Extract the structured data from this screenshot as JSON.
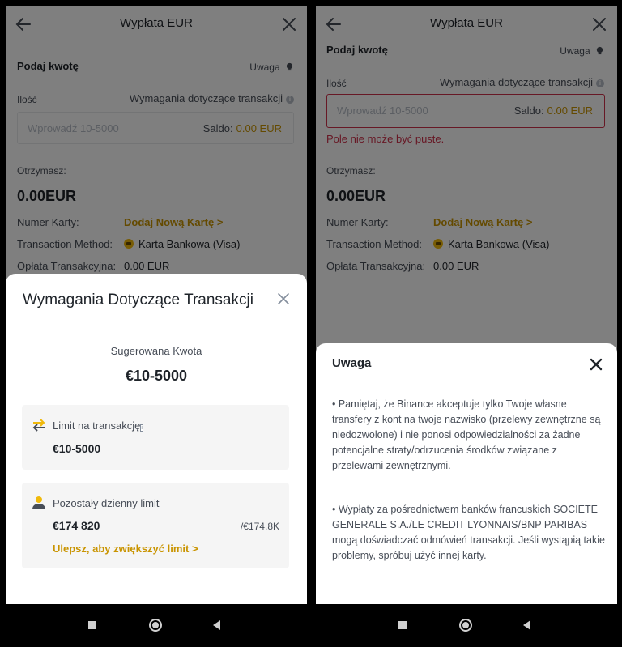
{
  "left": {
    "topbar": {
      "title": "Wypłata EUR"
    },
    "form": {
      "section_title": "Podaj kwotę",
      "notice_label": "Uwaga",
      "quantity_label": "Ilość",
      "requirements_link": "Wymagania dotyczące transakcji",
      "amount_placeholder": "Wprowadź 10-5000",
      "balance_label": "Saldo:",
      "balance_value": "0.00 EUR",
      "receive_label": "Otrzymasz:",
      "receive_value": "0.00EUR",
      "card_label": "Numer Karty:",
      "card_link": "Dodaj Nową Kartę >",
      "method_label": "Transaction Method:",
      "method_value": "Karta Bankowa (Visa)",
      "fee_label": "Opłata Transakcyjna:",
      "fee_value": "0.00 EUR"
    },
    "sheet": {
      "title": "Wymagania Dotyczące Transakcji",
      "suggested_label": "Sugerowana Kwota",
      "suggested_value": "€10-5000",
      "limit_label": "Limit na transakcję",
      "limit_value": "€10-5000",
      "daily_label": "Pozostały dzienny limit",
      "daily_value": "€174 820",
      "daily_total": "/€174.8K",
      "upgrade_link": "Ulepsz, aby zwiększyć limit >"
    }
  },
  "right": {
    "topbar": {
      "title": "Wypłata EUR"
    },
    "form": {
      "section_title": "Podaj kwotę",
      "notice_label": "Uwaga",
      "quantity_label": "Ilość",
      "requirements_link": "Wymagania dotyczące transakcji",
      "amount_placeholder": "Wprowadź 10-5000",
      "balance_label": "Saldo:",
      "balance_value": "0.00 EUR",
      "error_text": "Pole nie może być puste.",
      "receive_label": "Otrzymasz:",
      "receive_value": "0.00EUR",
      "card_label": "Numer Karty:",
      "card_link": "Dodaj Nową Kartę >",
      "method_label": "Transaction Method:",
      "method_value": "Karta Bankowa (Visa)",
      "fee_label": "Opłata Transakcyjna:",
      "fee_value": "0.00 EUR"
    },
    "sheet": {
      "title": "Uwaga",
      "para1": "• Pamiętaj, że Binance akceptuje tylko Twoje własne transfery z kont na twoje nazwisko (przelewy zewnętrzne są niedozwolone) i nie ponosi odpowiedzialności za żadne potencjalne straty/odrzucenia środków związane z przelewami zewnętrznymi.",
      "para2": "• Wypłaty za pośrednictwem banków francuskich SOCIETE GENERALE S.A./LE CREDIT LYONNAIS/BNP PARIBAS mogą doświadczać odmówień transakcji. Jeśli wystąpią takie problemy, spróbuj użyć innej karty."
    }
  },
  "icons": {
    "back": "arrow-left-icon",
    "close": "close-icon",
    "notice": "lightbulb-icon",
    "info": "info-icon",
    "card": "card-icon",
    "transfer": "transfer-arrows-icon",
    "user": "user-icon",
    "nav_recents": "square-icon",
    "nav_home": "circle-icon",
    "nav_back": "triangle-back-icon"
  },
  "colors": {
    "accent": "#c99400",
    "error": "#cf304a",
    "icon_yellow": "#f0b90b"
  }
}
